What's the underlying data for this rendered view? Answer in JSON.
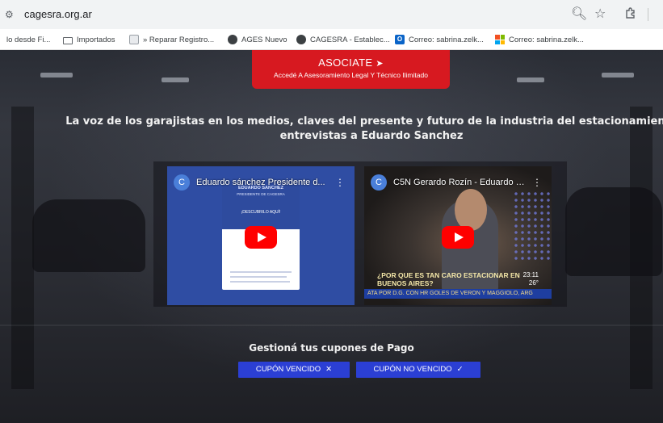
{
  "browser": {
    "url": "cagesra.org.ar",
    "bookmarks": [
      {
        "label": "lo desde Fi...",
        "icon": "generic-icon"
      },
      {
        "label": "Importados",
        "icon": "folder-icon"
      },
      {
        "label": "» Reparar Registro...",
        "icon": "generic-icon"
      },
      {
        "label": "AGES Nuevo",
        "icon": "globe-icon"
      },
      {
        "label": "CAGESRA - Establec...",
        "icon": "globe-icon"
      },
      {
        "label": "Correo: sabrina.zelk...",
        "icon": "outlook-icon"
      },
      {
        "label": "Correo: sabrina.zelk...",
        "icon": "microsoft-icon"
      }
    ]
  },
  "cta": {
    "title": "ASOCIATE",
    "subtitle": "Accedé A Asesoramiento Legal Y Técnico Ilimitado"
  },
  "headline": {
    "line1": "La voz de los garajistas en los medios, claves del presente y futuro de la industria del estacionamiento",
    "line2": "entrevistas a Eduardo Sanchez"
  },
  "videos": [
    {
      "channel_initial": "C",
      "title": "Eduardo sánchez Presidente d...",
      "thumb_heading": "EDUARDO SANCHEZ",
      "thumb_subheading": "PRESIDENTE DE CAGESRA",
      "thumb_cta": "¡DESCUBRILO AQUÍ!"
    },
    {
      "channel_initial": "C",
      "title": "C5N Gerardo Rozín - Eduardo S...",
      "caption": "¿POR QUE ES TAN CARO ESTACIONAR EN BUENOS AIRES?",
      "time": "23:11",
      "temp": "26°",
      "ticker": "ATA POR D.G. CON HR GOLES DE VERON Y MAGGIOLO, ARG"
    }
  ],
  "coupons": {
    "title": "Gestioná tus cupones de Pago",
    "expired_label": "CUPÓN VENCIDO",
    "not_expired_label": "CUPÓN NO VENCIDO"
  },
  "colors": {
    "cta_red": "#d71920",
    "button_blue": "#2b3fd4",
    "youtube_red": "#ff0000"
  }
}
